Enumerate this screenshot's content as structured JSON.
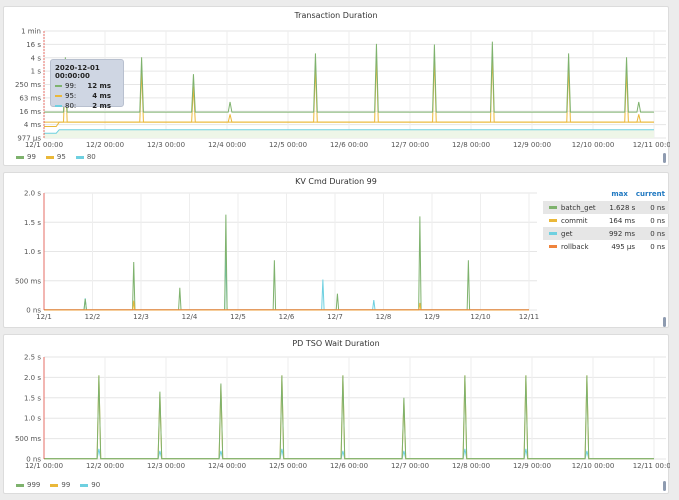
{
  "colors": {
    "green": "#7eb26d",
    "yellow": "#eab839",
    "cyan": "#6ed0e0",
    "orange": "#ef843c",
    "red": "#e24d42"
  },
  "panel1": {
    "title": "Transaction Duration",
    "y_ticks": [
      "1 min",
      "16 s",
      "4 s",
      "1 s",
      "250 ms",
      "63 ms",
      "16 ms",
      "4 ms",
      "977 µs"
    ],
    "x_ticks": [
      "12/1 00:00",
      "12/2 00:00",
      "12/3 00:00",
      "12/4 00:00",
      "12/5 00:00",
      "12/6 00:00",
      "12/7 00:00",
      "12/8 00:00",
      "12/9 00:00",
      "12/10 00:00",
      "12/11 00:00"
    ],
    "legend": [
      {
        "label": "99",
        "color": "#7eb26d"
      },
      {
        "label": "95",
        "color": "#eab839"
      },
      {
        "label": "80",
        "color": "#6ed0e0"
      }
    ],
    "tooltip": {
      "time": "2020-12-01 00:00:00",
      "rows": [
        {
          "name": "99:",
          "value": "12 ms",
          "color": "#7eb26d"
        },
        {
          "name": "95:",
          "value": "4 ms",
          "color": "#eab839"
        },
        {
          "name": "80:",
          "value": "2 ms",
          "color": "#6ed0e0"
        }
      ]
    }
  },
  "panel2": {
    "title": "KV Cmd Duration 99",
    "y_ticks": [
      "2.0 s",
      "1.5 s",
      "1.0 s",
      "500 ms",
      "0 ns"
    ],
    "x_ticks": [
      "12/1",
      "12/2",
      "12/3",
      "12/4",
      "12/5",
      "12/6",
      "12/7",
      "12/8",
      "12/9",
      "12/10",
      "12/11"
    ],
    "legend_header": {
      "max": "max",
      "current": "current"
    },
    "legend": [
      {
        "name": "batch_get",
        "max": "1.628 s",
        "current": "0 ns",
        "color": "#7eb26d"
      },
      {
        "name": "commit",
        "max": "164 ms",
        "current": "0 ns",
        "color": "#eab839"
      },
      {
        "name": "get",
        "max": "992 ms",
        "current": "0 ns",
        "color": "#6ed0e0"
      },
      {
        "name": "rollback",
        "max": "495 µs",
        "current": "0 ns",
        "color": "#ef843c"
      }
    ]
  },
  "panel3": {
    "title": "PD TSO Wait Duration",
    "y_ticks": [
      "2.5 s",
      "2.0 s",
      "1.5 s",
      "1.0 s",
      "500 ms",
      "0 ns"
    ],
    "x_ticks": [
      "12/1 00:00",
      "12/2 00:00",
      "12/3 00:00",
      "12/4 00:00",
      "12/5 00:00",
      "12/6 00:00",
      "12/7 00:00",
      "12/8 00:00",
      "12/9 00:00",
      "12/10 00:00",
      "12/11 00:00"
    ],
    "legend": [
      {
        "label": "999",
        "color": "#7eb26d"
      },
      {
        "label": "99",
        "color": "#eab839"
      },
      {
        "label": "90",
        "color": "#6ed0e0"
      }
    ]
  },
  "chart_data": [
    {
      "type": "line",
      "title": "Transaction Duration",
      "y_scale": "log",
      "x": [
        "12/1",
        "12/2",
        "12/3",
        "12/4",
        "12/5",
        "12/6",
        "12/7",
        "12/8",
        "12/9",
        "12/10",
        "12/11"
      ],
      "series": [
        {
          "name": "99",
          "spikes": [
            [
              "12/1 09:00",
              "4 s"
            ],
            [
              "12/2 14:00",
              "4 s"
            ],
            [
              "12/4 13:00",
              "1 s"
            ],
            [
              "12/5 11:00",
              "8 s"
            ],
            [
              "12/6 10:00",
              "16 s"
            ],
            [
              "12/7 08:00",
              "16 s"
            ],
            [
              "12/8 07:00",
              "20 s"
            ],
            [
              "12/9 13:00",
              "8 s"
            ],
            [
              "12/10 11:00",
              "4 s"
            ]
          ],
          "baseline": "12 ms"
        },
        {
          "name": "95",
          "baseline": "4 ms"
        },
        {
          "name": "80",
          "baseline": "2 ms"
        }
      ]
    },
    {
      "type": "line",
      "title": "KV Cmd Duration 99",
      "ylim": [
        "0 ns",
        "2.0 s"
      ],
      "series": [
        {
          "name": "batch_get",
          "max": "1.628 s",
          "spikes_s": [
            [
              1.85,
              0.19
            ],
            [
              2.85,
              0.82
            ],
            [
              3.8,
              0.38
            ],
            [
              4.75,
              1.63
            ],
            [
              5.75,
              0.85
            ],
            [
              7.05,
              0.28
            ],
            [
              8.75,
              1.6
            ],
            [
              9.75,
              0.85
            ]
          ]
        },
        {
          "name": "commit",
          "max": "164 ms"
        },
        {
          "name": "get",
          "max": "992 ms",
          "spikes_s": [
            [
              1.85,
              0.2
            ],
            [
              4.75,
              1.0
            ],
            [
              6.75,
              0.52
            ],
            [
              7.8,
              0.17
            ]
          ]
        },
        {
          "name": "rollback",
          "max": "495 µs"
        }
      ]
    },
    {
      "type": "line",
      "title": "PD TSO Wait Duration",
      "ylim": [
        "0 ns",
        "2.5 s"
      ],
      "series": [
        {
          "name": "999",
          "spikes_s": [
            [
              1.9,
              2.05
            ],
            [
              2.9,
              1.65
            ],
            [
              3.9,
              1.85
            ],
            [
              4.9,
              2.05
            ],
            [
              5.9,
              2.05
            ],
            [
              6.9,
              1.5
            ],
            [
              7.9,
              2.05
            ],
            [
              8.9,
              2.05
            ],
            [
              9.9,
              2.05
            ]
          ]
        },
        {
          "name": "99",
          "spikes_s": [
            [
              1.9,
              2.05
            ],
            [
              2.9,
              1.6
            ],
            [
              3.9,
              1.8
            ],
            [
              4.9,
              2.05
            ],
            [
              5.9,
              2.05
            ],
            [
              6.9,
              1.45
            ],
            [
              7.9,
              2.05
            ],
            [
              8.9,
              2.05
            ],
            [
              9.9,
              2.05
            ]
          ]
        },
        {
          "name": "90",
          "spikes_s": [
            [
              1.9,
              0.25
            ],
            [
              2.9,
              0.2
            ],
            [
              3.9,
              0.2
            ],
            [
              4.9,
              0.25
            ],
            [
              5.9,
              0.2
            ],
            [
              6.9,
              0.2
            ],
            [
              7.9,
              0.25
            ],
            [
              8.9,
              0.25
            ],
            [
              9.9,
              0.2
            ]
          ]
        }
      ]
    }
  ]
}
